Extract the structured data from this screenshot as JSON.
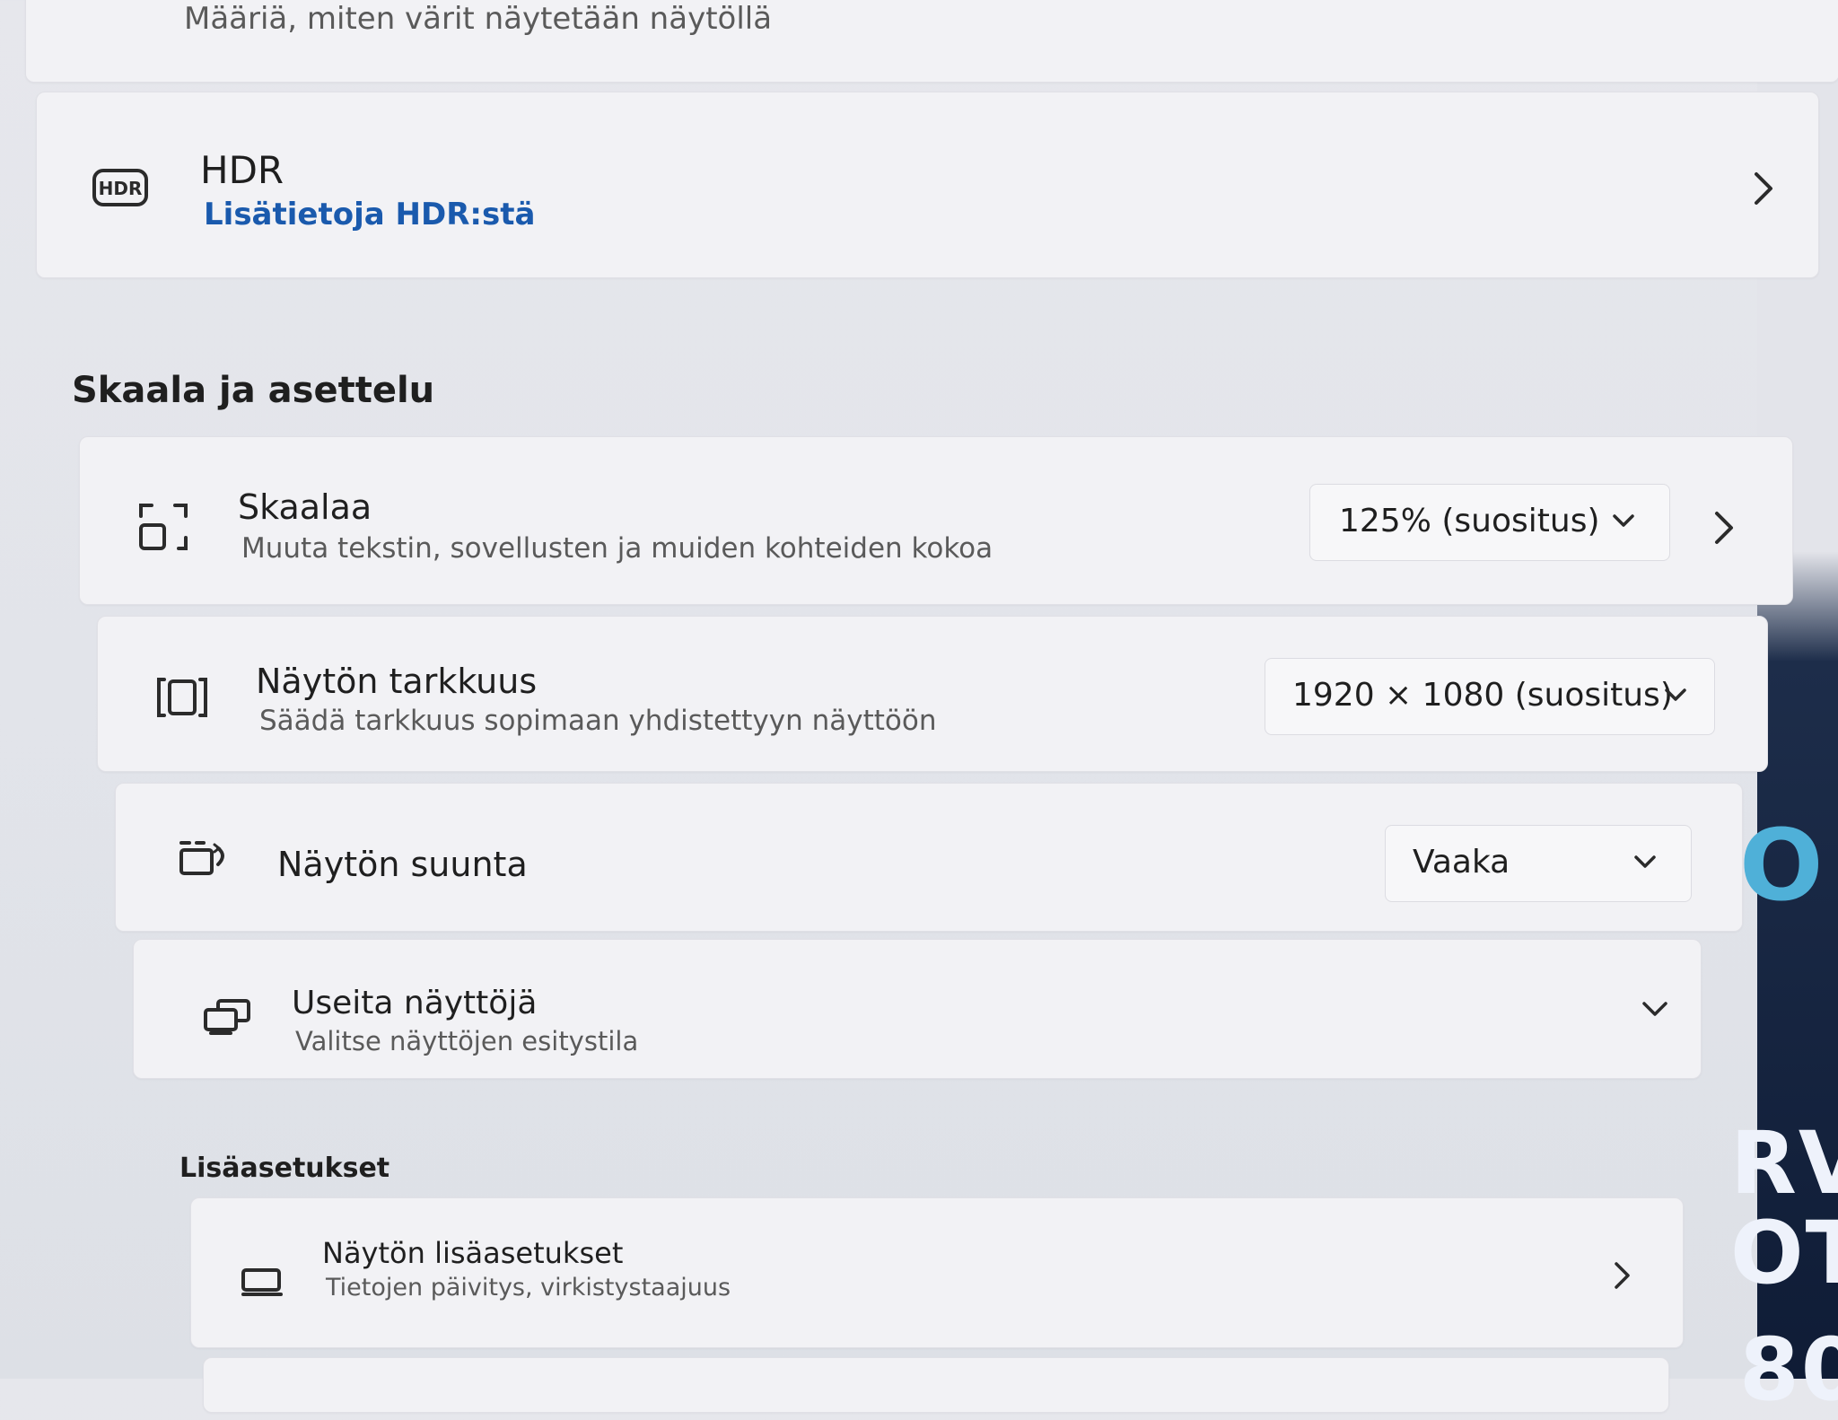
{
  "color_row": {
    "subtitle": "Määriä, miten värit näytetään näytöllä"
  },
  "hdr": {
    "title": "HDR",
    "link": "Lisätietoja HDR:stä",
    "icon_text": "HDR",
    "icon": "hdr-icon"
  },
  "sections": {
    "scale_layout": "Skaala ja asettelu",
    "more_settings": "Lisäasetukset"
  },
  "scale": {
    "title": "Skaalaa",
    "subtitle": "Muuta tekstin, sovellusten ja muiden kohteiden kokoa",
    "value": "125% (suositus)",
    "icon": "scale-icon"
  },
  "resolution": {
    "title": "Näytön tarkkuus",
    "subtitle": "Säädä tarkkuus sopimaan yhdistettyyn näyttöön",
    "value": "1920 × 1080 (suositus)",
    "icon": "resolution-icon"
  },
  "orientation": {
    "title": "Näytön suunta",
    "value": "Vaaka",
    "icon": "orientation-icon"
  },
  "multi_display": {
    "title": "Useita näyttöjä",
    "subtitle": "Valitse näyttöjen esitystila",
    "icon": "multiple-displays-icon"
  },
  "advanced_display": {
    "title": "Näytön lisäasetukset",
    "subtitle": "Tietojen päivitys, virkistystaajuus",
    "icon": "monitor-icon"
  },
  "background_poster": {
    "letters": [
      "O",
      "RVI",
      "OT",
      "80"
    ]
  }
}
